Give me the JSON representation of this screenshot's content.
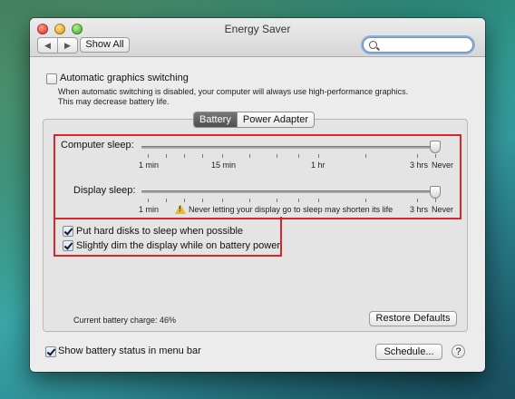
{
  "window": {
    "title": "Energy Saver"
  },
  "toolbar": {
    "back_label": "◀",
    "forward_label": "▶",
    "show_all_label": "Show All",
    "search_placeholder": ""
  },
  "graphics": {
    "checkbox_label": "Automatic graphics switching",
    "checked": false,
    "description_line1": "When automatic switching is disabled, your computer will always use high-performance graphics.",
    "description_line2": "This may decrease battery life."
  },
  "tabs": [
    {
      "label": "Battery",
      "active": true
    },
    {
      "label": "Power Adapter",
      "active": false
    }
  ],
  "computer_sleep": {
    "label": "Computer sleep:",
    "ticks": {
      "t1": "1 min",
      "t2": "15 min",
      "t3": "1 hr",
      "t4": "3 hrs",
      "t5": "Never"
    },
    "value": "Never"
  },
  "display_sleep": {
    "label": "Display sleep:",
    "ticks": {
      "t1": "1 min",
      "t4": "3 hrs",
      "t5": "Never"
    },
    "value": "Never",
    "warning": "Never letting your display go to sleep may shorten its life"
  },
  "options": {
    "hard_disks_label": "Put hard disks to sleep when possible",
    "hard_disks_checked": true,
    "dim_display_label": "Slightly dim the display while on battery power",
    "dim_display_checked": true
  },
  "battery_charge": "Current battery charge: 46%",
  "restore_label": "Restore Defaults",
  "status_menu": {
    "label": "Show battery status in menu bar",
    "checked": true
  },
  "schedule_label": "Schedule...",
  "help_label": "?",
  "highlight_color": "#d9252b"
}
